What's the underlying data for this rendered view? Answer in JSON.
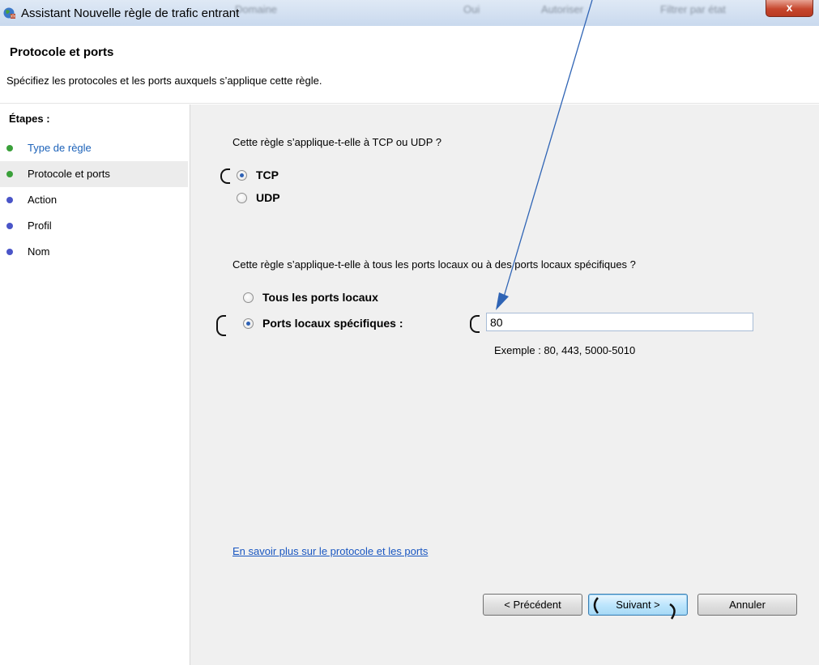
{
  "window": {
    "title": "Assistant Nouvelle règle de trafic entrant",
    "close_label": "x",
    "background_ghost": [
      "Domaine",
      "Oui",
      "Autoriser",
      "Filtrer par état"
    ]
  },
  "header": {
    "title": "Protocole et ports",
    "description": "Spécifiez les protocoles et les ports auxquels s’applique cette règle."
  },
  "sidebar": {
    "title": "Étapes :",
    "items": [
      {
        "label": "Type de règle",
        "state": "done",
        "dot_color": "#3aa03a"
      },
      {
        "label": "Protocole et ports",
        "state": "active",
        "dot_color": "#3aa03a"
      },
      {
        "label": "Action",
        "state": "pending",
        "dot_color": "#4a55c8"
      },
      {
        "label": "Profil",
        "state": "pending",
        "dot_color": "#4a55c8"
      },
      {
        "label": "Nom",
        "state": "pending",
        "dot_color": "#4a55c8"
      }
    ]
  },
  "protocol": {
    "question": "Cette règle s’applique-t-elle à TCP ou UDP ?",
    "options": [
      {
        "label": "TCP",
        "checked": true
      },
      {
        "label": "UDP",
        "checked": false
      }
    ]
  },
  "ports": {
    "question": "Cette règle s’applique-t-elle à tous les ports locaux ou à des ports locaux spécifiques ?",
    "options": [
      {
        "label": "Tous les ports locaux",
        "checked": false
      },
      {
        "label": "Ports locaux spécifiques :",
        "checked": true
      }
    ],
    "input_value": "80",
    "example": "Exemple : 80, 443, 5000-5010"
  },
  "link": {
    "label": "En savoir plus sur le protocole et les ports"
  },
  "buttons": {
    "back": "< Précédent",
    "next": "Suivant >",
    "cancel": "Annuler"
  }
}
